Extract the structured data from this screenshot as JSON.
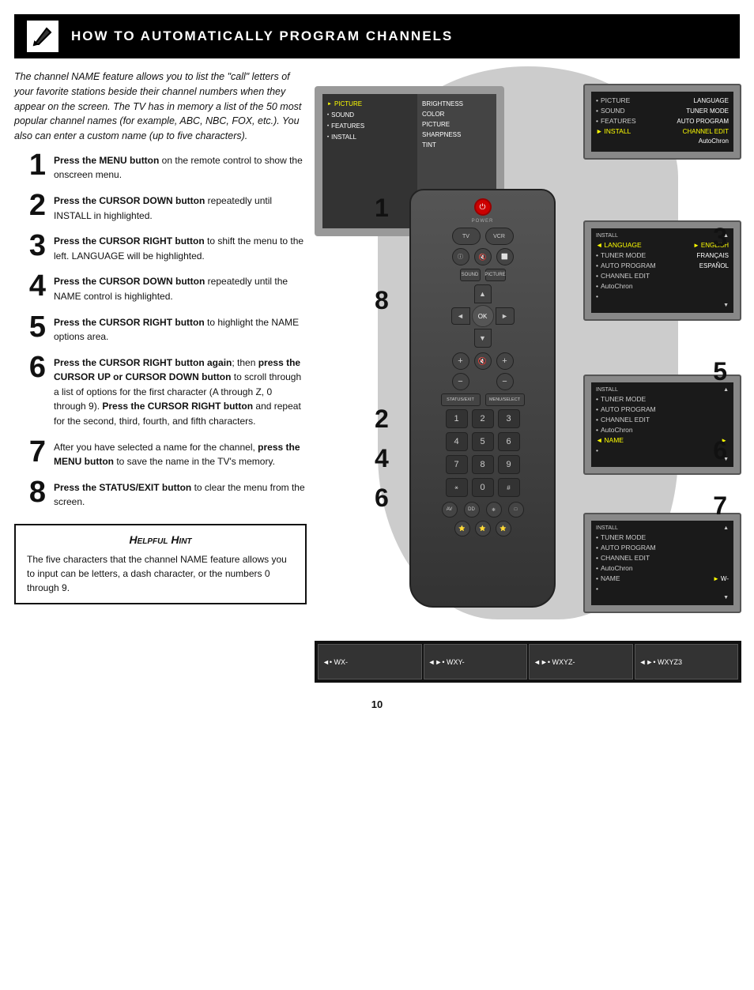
{
  "header": {
    "title": "How to Automatically Program Channels",
    "icon": "pencil"
  },
  "intro": {
    "text": "The channel NAME feature allows you to list the \"call\" letters of your favorite stations beside their channel numbers when they appear on the screen. The TV has in memory a list of the 50 most popular channel names (for example, ABC, NBC, FOX, etc.). You also can enter a custom name (up to five characters)."
  },
  "steps": [
    {
      "number": "1",
      "text": "Press the MENU button on the remote control to show the onscreen menu."
    },
    {
      "number": "2",
      "text": "Press the CURSOR DOWN button repeatedly until INSTALL in highlighted."
    },
    {
      "number": "3",
      "text": "Press the CURSOR RIGHT button to shift the menu to the left. LANGUAGE will be highlighted."
    },
    {
      "number": "4",
      "text": "Press the CURSOR DOWN button repeatedly until the NAME control is highlighted."
    },
    {
      "number": "5",
      "text": "Press the CURSOR RIGHT button to highlight the NAME options area."
    },
    {
      "number": "6",
      "text": "Press the CURSOR RIGHT button again; then press the CURSOR UP or CURSOR DOWN button to scroll through a list of options for the first character (A through Z, 0 through 9). Press the CURSOR RIGHT button and repeat for the second, third, fourth, and fifth characters."
    },
    {
      "number": "7",
      "text": "After you have selected a name for the channel, press the MENU button to save the name in the TV's memory."
    },
    {
      "number": "8",
      "text": "Press the STATUS/EXIT button to clear the menu from the screen."
    }
  ],
  "hint": {
    "title": "Helpful Hint",
    "text": "The five characters that the channel NAME feature allows you to input can be letters, a dash character, or the numbers 0 through 9."
  },
  "osd_main": {
    "items_left": [
      {
        "label": "PICTURE",
        "selected": true,
        "arrow": true
      },
      {
        "label": "SOUND"
      },
      {
        "label": "FEATURES"
      },
      {
        "label": "INSTALL"
      }
    ],
    "items_right": [
      "BRIGHTNESS",
      "COLOR",
      "PICTURE",
      "SHARPNESS",
      "TINT"
    ]
  },
  "osd_panel1": {
    "title": "",
    "items_left": [
      "PICTURE",
      "SOUND",
      "FEATURES",
      "INSTALL"
    ],
    "items_right": [
      "LANGUAGE",
      "TUNER MODE",
      "AUTO PROGRAM",
      "CHANNEL EDIT",
      "AutoChron"
    ],
    "highlighted_left": "INSTALL"
  },
  "osd_panel2": {
    "title": "INSTALL",
    "items": [
      "LANGUAGE",
      "TUNER MODE",
      "AUTO PROGRAM",
      "CHANNEL EDIT",
      "AutoChron"
    ],
    "highlighted": "LANGUAGE",
    "right_items": [
      "ENGLISH",
      "FRANÇAIS",
      "ESPAÑOL"
    ]
  },
  "osd_panel3": {
    "title": "INSTALL",
    "items": [
      "TUNER MODE",
      "AUTO PROGRAM",
      "CHANNEL EDIT",
      "AutoChron",
      "NAME"
    ],
    "highlighted": "NAME"
  },
  "osd_panel4": {
    "title": "INSTALL",
    "items": [
      "TUNER MODE",
      "AUTO PROGRAM",
      "CHANNEL EDIT",
      "AutoChron",
      "NAME"
    ],
    "highlighted": "NAME",
    "name_val": "W-"
  },
  "char_panels": [
    {
      "label": "◄• WX-"
    },
    {
      "label": "◄►• WXY-"
    },
    {
      "label": "◄►• WXYZ-"
    },
    {
      "label": "◄►• WXYZ3"
    }
  ],
  "step_overlays": {
    "num1": "1",
    "num2": "2",
    "num3": "3",
    "num4": "4",
    "num5": "5",
    "num6": "6",
    "num7": "7",
    "num8": "8"
  },
  "page_number": "10",
  "numpad": [
    "1",
    "2",
    "3",
    "4",
    "5",
    "6",
    "7",
    "8",
    "9",
    "",
    "0",
    ""
  ]
}
